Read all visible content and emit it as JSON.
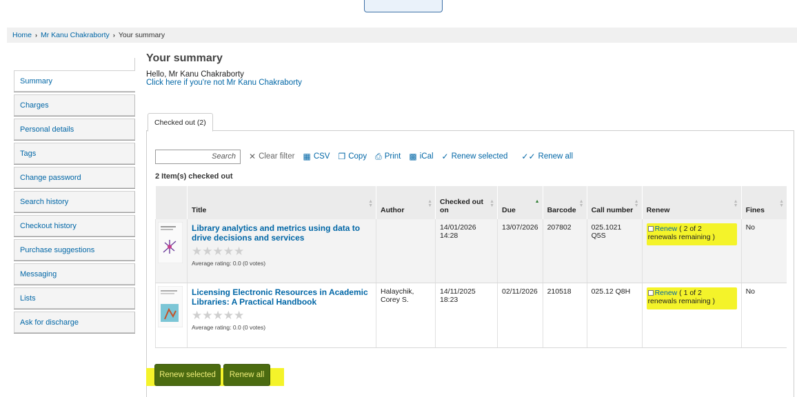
{
  "breadcrumb": {
    "home": "Home",
    "patron": "Mr Kanu Chakraborty",
    "current": "Your summary"
  },
  "sidebar": {
    "items": [
      {
        "label": "Summary",
        "active": true
      },
      {
        "label": "Charges"
      },
      {
        "label": "Personal details"
      },
      {
        "label": "Tags"
      },
      {
        "label": "Change password"
      },
      {
        "label": "Search history"
      },
      {
        "label": "Checkout history"
      },
      {
        "label": "Purchase suggestions"
      },
      {
        "label": "Messaging"
      },
      {
        "label": "Lists"
      },
      {
        "label": "Ask for discharge"
      }
    ]
  },
  "main": {
    "title": "Your summary",
    "hello": "Hello, Mr Kanu Chakraborty",
    "not_me_link": "Click here if you're not Mr Kanu Chakraborty",
    "tab_label": "Checked out (2)",
    "search_placeholder": "Search",
    "toolbar": {
      "clear_filter": "Clear filter",
      "csv": "CSV",
      "copy": "Copy",
      "print": "Print",
      "ical": "iCal",
      "renew_selected": "Renew selected",
      "renew_all": "Renew all"
    },
    "count_text": "2 Item(s) checked out",
    "columns": {
      "title": "Title",
      "author": "Author",
      "checked_out_on": "Checked out on",
      "due": "Due",
      "barcode": "Barcode",
      "call_number": "Call number",
      "renew": "Renew",
      "fines": "Fines"
    },
    "rows": [
      {
        "title": "Library analytics and metrics using data to drive decisions and services",
        "author": "",
        "checked_out_on": "14/01/2026 14:28",
        "due": "13/07/2026",
        "barcode": "207802",
        "call_number": "025.1021 Q5S",
        "renew_link": "Renew",
        "renew_note": " ( 2 of 2 renewals remaining )",
        "fines": "No",
        "rating": "Average rating: 0.0 (0 votes)"
      },
      {
        "title": "Licensing Electronic Resources in Academic Libraries: A Practical Handbook",
        "author": "Halaychik, Corey S.",
        "checked_out_on": "14/11/2025 18:23",
        "due": "02/11/2026",
        "barcode": "210518",
        "call_number": "025.12 Q8H",
        "renew_link": "Renew",
        "renew_note": " ( 1 of 2 renewals remaining )",
        "fines": "No",
        "rating": "Average rating: 0.0 (0 votes)"
      }
    ],
    "buttons": {
      "renew_selected": "Renew selected",
      "renew_all": "Renew all"
    }
  },
  "colors": {
    "link": "#0066a6",
    "highlight": "#f4f32a",
    "button_bg": "#4b6b10",
    "button_text": "#f1ef7a"
  }
}
